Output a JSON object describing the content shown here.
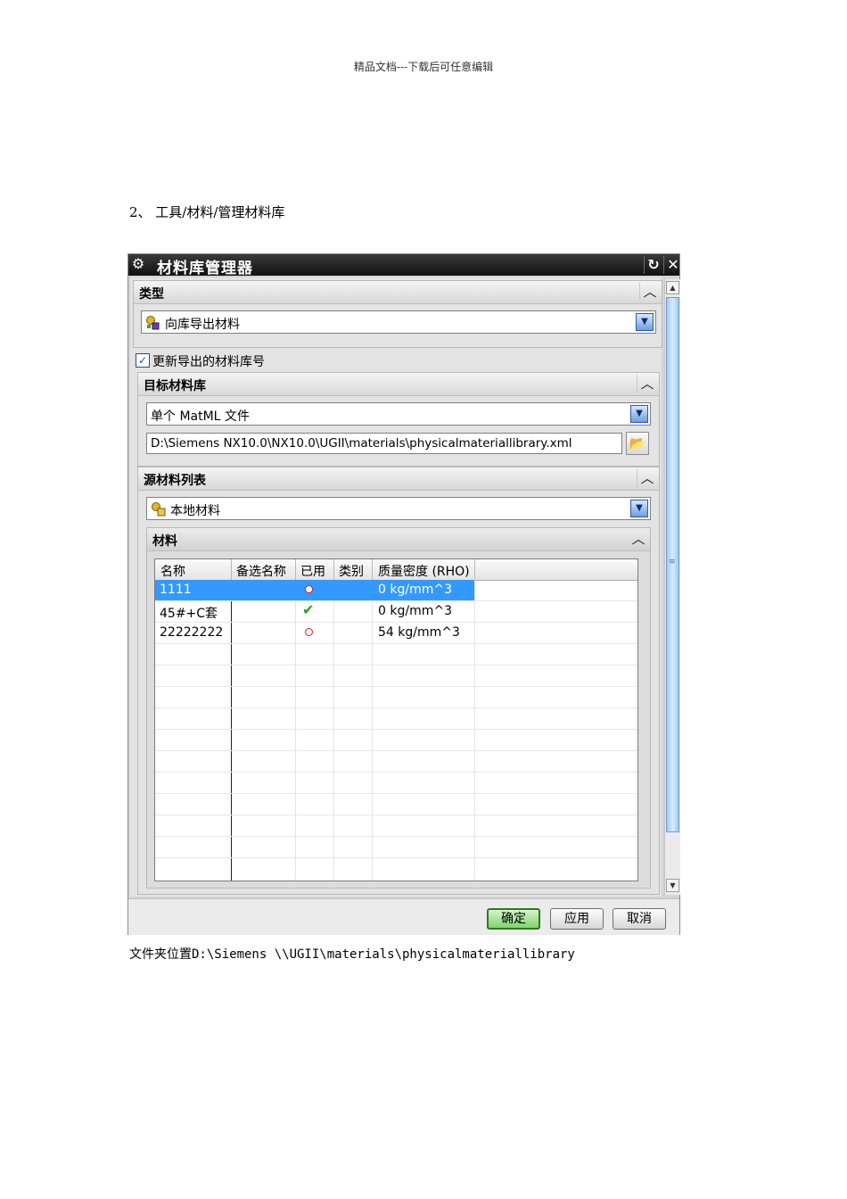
{
  "page": {
    "header_note": "精品文档---下载后可任意编辑",
    "step_text": "2、 工具/材料/管理材料库",
    "caption": "文件夹位置D:\\Siemens \\\\UGII\\materials\\physicalmateriallibrary"
  },
  "dialog": {
    "title": "材料库管理器",
    "type_group": {
      "label": "类型",
      "selected": "向库导出材料"
    },
    "update_checkbox": {
      "label": "更新导出的材料库号",
      "checked": true
    },
    "target_group": {
      "label": "目标材料库",
      "format_selected": "单个 MatML 文件",
      "path_value": "D:\\Siemens NX10.0\\NX10.0\\UGII\\materials\\physicalmateriallibrary.xml"
    },
    "source_group": {
      "label": "源材料列表",
      "selected": "本地材料"
    },
    "materials_group": {
      "label": "材料",
      "columns": [
        "名称",
        "备选名称",
        "已用",
        "类别",
        "质量密度 (RHO)"
      ],
      "rows": [
        {
          "name": "1111",
          "alt": "",
          "used": "no",
          "category": "",
          "density": "0 kg/mm^3",
          "selected": true
        },
        {
          "name": "45#+C套",
          "alt": "",
          "used": "yes",
          "category": "",
          "density": "0 kg/mm^3",
          "selected": false
        },
        {
          "name": "22222222",
          "alt": "",
          "used": "no",
          "category": "",
          "density": "54 kg/mm^3",
          "selected": false
        }
      ]
    },
    "buttons": {
      "ok": "确定",
      "apply": "应用",
      "cancel": "取消"
    }
  }
}
